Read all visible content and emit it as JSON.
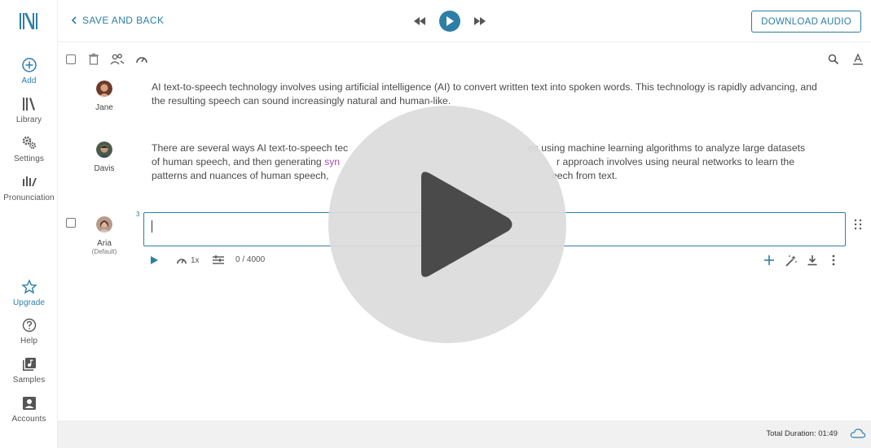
{
  "sidebar": {
    "items": [
      {
        "label": "Add",
        "icon": "plus-circle-icon"
      },
      {
        "label": "Library",
        "icon": "library-icon"
      },
      {
        "label": "Settings",
        "icon": "gears-icon"
      },
      {
        "label": "Pronunciation",
        "icon": "pronunciation-icon"
      },
      {
        "label": "Upgrade",
        "icon": "star-icon"
      },
      {
        "label": "Help",
        "icon": "help-circle-icon"
      },
      {
        "label": "Samples",
        "icon": "music-note-icon"
      },
      {
        "label": "Accounts",
        "icon": "account-box-icon"
      }
    ]
  },
  "header": {
    "back_label": "SAVE AND BACK",
    "download_label": "DOWNLOAD AUDIO"
  },
  "blocks": [
    {
      "speaker": "Jane",
      "text": "AI text-to-speech technology involves using artificial intelligence (AI) to convert written text into spoken words. This technology is rapidly advancing, and the resulting speech can sound increasingly natural and human-like."
    },
    {
      "speaker": "Davis",
      "text_parts": [
        "There are several ways AI text-to-speech tec",
        "es using machine learning algorithms to analyze large datasets",
        "of human speech, and then generating ",
        "syn",
        "r approach involves using neural networks to learn the",
        "patterns and nuances of human speech,",
        "eech from text."
      ]
    },
    {
      "line_number": "3",
      "speaker": "Aria",
      "speaker_sub": "(Default)",
      "text": ""
    }
  ],
  "controls": {
    "speed": "1x",
    "char_count": "0 / 4000"
  },
  "footer": {
    "total_duration": "Total Duration: 01:49"
  },
  "colors": {
    "accent": "#2d7ea6",
    "highlight": "#a44fb0"
  }
}
